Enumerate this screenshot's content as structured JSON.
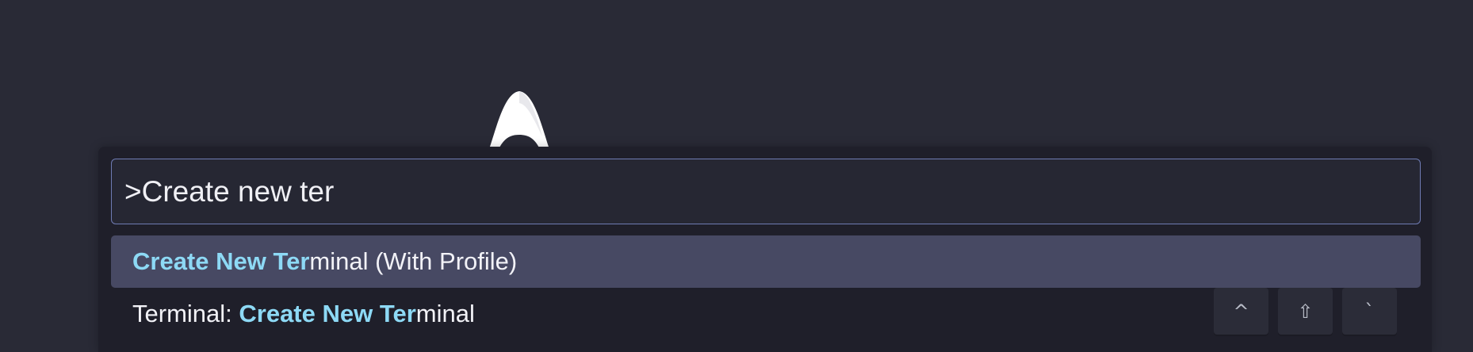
{
  "palette": {
    "input_value": ">Create new ter",
    "items": [
      {
        "prefix": "",
        "match": "Create New Ter",
        "suffix": "minal (With Profile)",
        "selected": true
      },
      {
        "prefix": "Terminal: ",
        "match": "Create New Ter",
        "suffix": "minal",
        "selected": false,
        "keybinding": [
          "^",
          "⇧",
          "`"
        ]
      }
    ]
  },
  "colors": {
    "background": "#292a36",
    "accent": "#8dd9f5",
    "selection": "#474963",
    "input_border": "#6f7bb3"
  }
}
